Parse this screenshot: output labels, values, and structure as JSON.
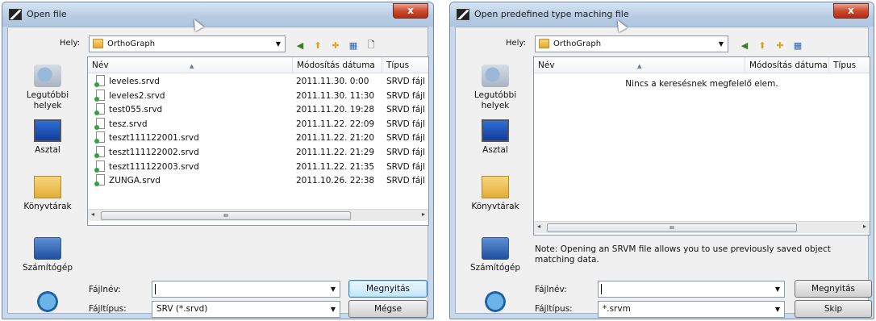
{
  "dialog1": {
    "title": "Open file",
    "close_label": "x",
    "lookin_label": "Hely:",
    "lookin_value": "OrthoGraph",
    "places": [
      "Legutóbbi helyek",
      "Asztal",
      "Könyvtárak",
      "Számítógép",
      ""
    ],
    "columns": [
      "Név",
      "Módosítás dátuma",
      "Típus"
    ],
    "files": [
      {
        "name": "leveles.srvd",
        "date": "2011.11.30. 0:00",
        "type": "SRVD fájl"
      },
      {
        "name": "leveles2.srvd",
        "date": "2011.11.30. 11:30",
        "type": "SRVD fájl"
      },
      {
        "name": "test055.srvd",
        "date": "2011.11.20. 19:28",
        "type": "SRVD fájl"
      },
      {
        "name": "tesz.srvd",
        "date": "2011.11.22. 22:09",
        "type": "SRVD fájl"
      },
      {
        "name": "teszt111122001.srvd",
        "date": "2011.11.22. 21:20",
        "type": "SRVD fájl"
      },
      {
        "name": "teszt111122002.srvd",
        "date": "2011.11.22. 21:29",
        "type": "SRVD fájl"
      },
      {
        "name": "teszt111122003.srvd",
        "date": "2011.11.22. 21:35",
        "type": "SRVD fájl"
      },
      {
        "name": "ZUNGA.srvd",
        "date": "2011.10.26. 22:38",
        "type": "SRVD fájl"
      }
    ],
    "filename_label": "Fájlnév:",
    "filename_value": "",
    "filetype_label": "Fájltípus:",
    "filetype_value": "SRV (*.srvd)",
    "open_button": "Megnyitás",
    "cancel_button": "Mégse"
  },
  "dialog2": {
    "title": "Open predefined type maching file",
    "close_label": "x",
    "lookin_label": "Hely:",
    "lookin_value": "OrthoGraph",
    "places": [
      "Legutóbbi helyek",
      "Asztal",
      "Könyvtárak",
      "Számítógép",
      ""
    ],
    "columns": [
      "Név",
      "Módosítás dátuma",
      "Típus"
    ],
    "empty_message": "Nincs a keresésnek megfelelő elem.",
    "note": "Note: Opening an SRVM file allows you to use previously saved object matching data.",
    "filename_label": "Fájlnév:",
    "filename_value": "",
    "filetype_label": "Fájltípus:",
    "filetype_value": "*.srvm",
    "open_button": "Megnyitás",
    "skip_button": "Skip"
  }
}
